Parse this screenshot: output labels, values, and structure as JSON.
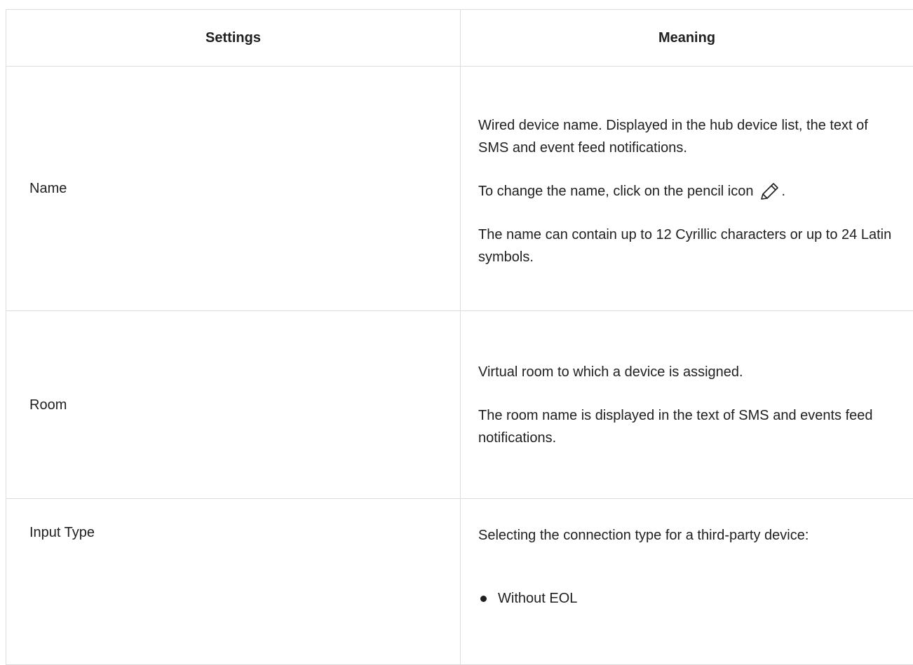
{
  "table": {
    "headers": {
      "settings": "Settings",
      "meaning": "Meaning"
    },
    "rows": [
      {
        "setting": "Name",
        "meaning": {
          "p1": "Wired device name. Displayed in the hub device list, the text of SMS and event feed notifications.",
          "p2": "To change the name, click on the pencil icon",
          "p2_suffix": ".",
          "p3": "The name can contain up to 12 Cyrillic characters or up to 24 Latin symbols."
        }
      },
      {
        "setting": "Room",
        "meaning": {
          "p1": "Virtual room to which a device is assigned.",
          "p2": "The room name is displayed in the text of SMS and events feed notifications."
        }
      },
      {
        "setting": "Input Type",
        "meaning": {
          "p1": "Selecting the connection type for a third-party device:",
          "list": [
            "Without EOL"
          ]
        }
      }
    ]
  },
  "icons": {
    "pencil": "pencil-icon"
  }
}
